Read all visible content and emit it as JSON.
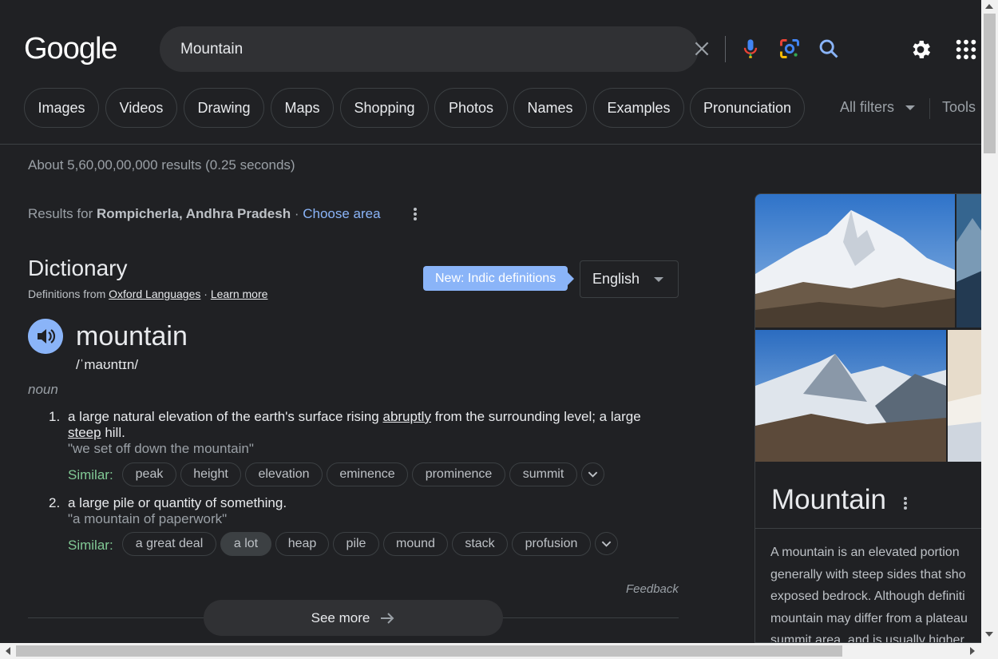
{
  "header": {
    "logo": "Google",
    "query": "Mountain"
  },
  "chips": [
    "Images",
    "Videos",
    "Drawing",
    "Maps",
    "Shopping",
    "Photos",
    "Names",
    "Examples",
    "Pronunciation"
  ],
  "filters": {
    "all_filters": "All filters",
    "tools": "Tools"
  },
  "results_stats": "About 5,60,00,00,000 results (0.25 seconds)",
  "location": {
    "prefix": "Results for",
    "place": "Rompicherla, Andhra Pradesh",
    "separator": "·",
    "link": "Choose area"
  },
  "dictionary": {
    "title": "Dictionary",
    "source_prefix": "Definitions from",
    "source": "Oxford Languages",
    "separator": "·",
    "learn_more": "Learn more",
    "new_badge": "New: Indic definitions",
    "language": "English",
    "word": "mountain",
    "phonetic": "/ˈmaʊntɪn/",
    "part_of_speech": "noun",
    "definitions": [
      {
        "num": "1.",
        "text_a": "a large natural elevation of the earth's surface rising ",
        "link1": "abruptly",
        "text_b": " from the surrounding level; a large ",
        "link2": "steep",
        "text_c": " hill.",
        "example": "\"we set off down the mountain\"",
        "similar_label": "Similar:",
        "similar": [
          "peak",
          "height",
          "elevation",
          "eminence",
          "prominence",
          "summit"
        ]
      },
      {
        "num": "2.",
        "text": "a large pile or quantity of something.",
        "example": "\"a mountain of paperwork\"",
        "similar_label": "Similar:",
        "similar": [
          "a great deal",
          "a lot",
          "heap",
          "pile",
          "mound",
          "stack",
          "profusion"
        ]
      }
    ],
    "feedback": "Feedback",
    "see_more": "See more"
  },
  "knowledge_panel": {
    "title": "Mountain",
    "description": [
      "A mountain is an elevated portion",
      "generally with steep sides that sho",
      "exposed bedrock. Although definiti",
      "mountain may differ from a plateau",
      "summit area, and is usually higher"
    ]
  },
  "colors": {
    "background": "#202124",
    "accent": "#8ab4f8",
    "similar_label": "#81c995"
  }
}
